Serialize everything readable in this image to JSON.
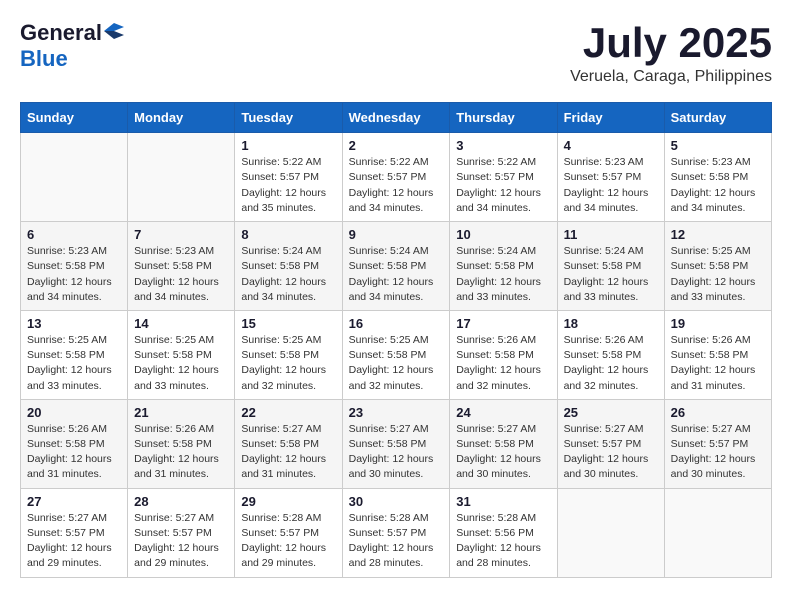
{
  "header": {
    "logo_general": "General",
    "logo_blue": "Blue",
    "month_title": "July 2025",
    "location": "Veruela, Caraga, Philippines"
  },
  "calendar": {
    "days_of_week": [
      "Sunday",
      "Monday",
      "Tuesday",
      "Wednesday",
      "Thursday",
      "Friday",
      "Saturday"
    ],
    "weeks": [
      [
        {
          "day": "",
          "sunrise": "",
          "sunset": "",
          "daylight": "",
          "empty": true
        },
        {
          "day": "",
          "sunrise": "",
          "sunset": "",
          "daylight": "",
          "empty": true
        },
        {
          "day": "1",
          "sunrise": "Sunrise: 5:22 AM",
          "sunset": "Sunset: 5:57 PM",
          "daylight": "Daylight: 12 hours and 35 minutes.",
          "empty": false
        },
        {
          "day": "2",
          "sunrise": "Sunrise: 5:22 AM",
          "sunset": "Sunset: 5:57 PM",
          "daylight": "Daylight: 12 hours and 34 minutes.",
          "empty": false
        },
        {
          "day": "3",
          "sunrise": "Sunrise: 5:22 AM",
          "sunset": "Sunset: 5:57 PM",
          "daylight": "Daylight: 12 hours and 34 minutes.",
          "empty": false
        },
        {
          "day": "4",
          "sunrise": "Sunrise: 5:23 AM",
          "sunset": "Sunset: 5:57 PM",
          "daylight": "Daylight: 12 hours and 34 minutes.",
          "empty": false
        },
        {
          "day": "5",
          "sunrise": "Sunrise: 5:23 AM",
          "sunset": "Sunset: 5:58 PM",
          "daylight": "Daylight: 12 hours and 34 minutes.",
          "empty": false
        }
      ],
      [
        {
          "day": "6",
          "sunrise": "Sunrise: 5:23 AM",
          "sunset": "Sunset: 5:58 PM",
          "daylight": "Daylight: 12 hours and 34 minutes.",
          "empty": false
        },
        {
          "day": "7",
          "sunrise": "Sunrise: 5:23 AM",
          "sunset": "Sunset: 5:58 PM",
          "daylight": "Daylight: 12 hours and 34 minutes.",
          "empty": false
        },
        {
          "day": "8",
          "sunrise": "Sunrise: 5:24 AM",
          "sunset": "Sunset: 5:58 PM",
          "daylight": "Daylight: 12 hours and 34 minutes.",
          "empty": false
        },
        {
          "day": "9",
          "sunrise": "Sunrise: 5:24 AM",
          "sunset": "Sunset: 5:58 PM",
          "daylight": "Daylight: 12 hours and 34 minutes.",
          "empty": false
        },
        {
          "day": "10",
          "sunrise": "Sunrise: 5:24 AM",
          "sunset": "Sunset: 5:58 PM",
          "daylight": "Daylight: 12 hours and 33 minutes.",
          "empty": false
        },
        {
          "day": "11",
          "sunrise": "Sunrise: 5:24 AM",
          "sunset": "Sunset: 5:58 PM",
          "daylight": "Daylight: 12 hours and 33 minutes.",
          "empty": false
        },
        {
          "day": "12",
          "sunrise": "Sunrise: 5:25 AM",
          "sunset": "Sunset: 5:58 PM",
          "daylight": "Daylight: 12 hours and 33 minutes.",
          "empty": false
        }
      ],
      [
        {
          "day": "13",
          "sunrise": "Sunrise: 5:25 AM",
          "sunset": "Sunset: 5:58 PM",
          "daylight": "Daylight: 12 hours and 33 minutes.",
          "empty": false
        },
        {
          "day": "14",
          "sunrise": "Sunrise: 5:25 AM",
          "sunset": "Sunset: 5:58 PM",
          "daylight": "Daylight: 12 hours and 33 minutes.",
          "empty": false
        },
        {
          "day": "15",
          "sunrise": "Sunrise: 5:25 AM",
          "sunset": "Sunset: 5:58 PM",
          "daylight": "Daylight: 12 hours and 32 minutes.",
          "empty": false
        },
        {
          "day": "16",
          "sunrise": "Sunrise: 5:25 AM",
          "sunset": "Sunset: 5:58 PM",
          "daylight": "Daylight: 12 hours and 32 minutes.",
          "empty": false
        },
        {
          "day": "17",
          "sunrise": "Sunrise: 5:26 AM",
          "sunset": "Sunset: 5:58 PM",
          "daylight": "Daylight: 12 hours and 32 minutes.",
          "empty": false
        },
        {
          "day": "18",
          "sunrise": "Sunrise: 5:26 AM",
          "sunset": "Sunset: 5:58 PM",
          "daylight": "Daylight: 12 hours and 32 minutes.",
          "empty": false
        },
        {
          "day": "19",
          "sunrise": "Sunrise: 5:26 AM",
          "sunset": "Sunset: 5:58 PM",
          "daylight": "Daylight: 12 hours and 31 minutes.",
          "empty": false
        }
      ],
      [
        {
          "day": "20",
          "sunrise": "Sunrise: 5:26 AM",
          "sunset": "Sunset: 5:58 PM",
          "daylight": "Daylight: 12 hours and 31 minutes.",
          "empty": false
        },
        {
          "day": "21",
          "sunrise": "Sunrise: 5:26 AM",
          "sunset": "Sunset: 5:58 PM",
          "daylight": "Daylight: 12 hours and 31 minutes.",
          "empty": false
        },
        {
          "day": "22",
          "sunrise": "Sunrise: 5:27 AM",
          "sunset": "Sunset: 5:58 PM",
          "daylight": "Daylight: 12 hours and 31 minutes.",
          "empty": false
        },
        {
          "day": "23",
          "sunrise": "Sunrise: 5:27 AM",
          "sunset": "Sunset: 5:58 PM",
          "daylight": "Daylight: 12 hours and 30 minutes.",
          "empty": false
        },
        {
          "day": "24",
          "sunrise": "Sunrise: 5:27 AM",
          "sunset": "Sunset: 5:58 PM",
          "daylight": "Daylight: 12 hours and 30 minutes.",
          "empty": false
        },
        {
          "day": "25",
          "sunrise": "Sunrise: 5:27 AM",
          "sunset": "Sunset: 5:57 PM",
          "daylight": "Daylight: 12 hours and 30 minutes.",
          "empty": false
        },
        {
          "day": "26",
          "sunrise": "Sunrise: 5:27 AM",
          "sunset": "Sunset: 5:57 PM",
          "daylight": "Daylight: 12 hours and 30 minutes.",
          "empty": false
        }
      ],
      [
        {
          "day": "27",
          "sunrise": "Sunrise: 5:27 AM",
          "sunset": "Sunset: 5:57 PM",
          "daylight": "Daylight: 12 hours and 29 minutes.",
          "empty": false
        },
        {
          "day": "28",
          "sunrise": "Sunrise: 5:27 AM",
          "sunset": "Sunset: 5:57 PM",
          "daylight": "Daylight: 12 hours and 29 minutes.",
          "empty": false
        },
        {
          "day": "29",
          "sunrise": "Sunrise: 5:28 AM",
          "sunset": "Sunset: 5:57 PM",
          "daylight": "Daylight: 12 hours and 29 minutes.",
          "empty": false
        },
        {
          "day": "30",
          "sunrise": "Sunrise: 5:28 AM",
          "sunset": "Sunset: 5:57 PM",
          "daylight": "Daylight: 12 hours and 28 minutes.",
          "empty": false
        },
        {
          "day": "31",
          "sunrise": "Sunrise: 5:28 AM",
          "sunset": "Sunset: 5:56 PM",
          "daylight": "Daylight: 12 hours and 28 minutes.",
          "empty": false
        },
        {
          "day": "",
          "sunrise": "",
          "sunset": "",
          "daylight": "",
          "empty": true
        },
        {
          "day": "",
          "sunrise": "",
          "sunset": "",
          "daylight": "",
          "empty": true
        }
      ]
    ]
  }
}
